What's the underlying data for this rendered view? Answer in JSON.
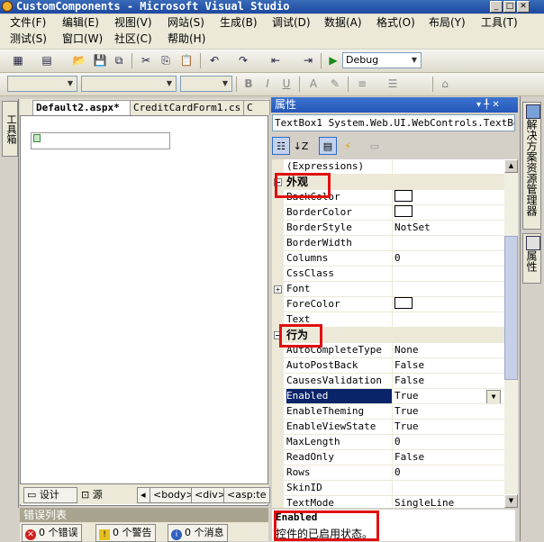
{
  "window": {
    "title": "CustomComponents - Microsoft Visual Studio"
  },
  "menu": {
    "row1": [
      "文件(F)",
      "编辑(E)",
      "视图(V)",
      "网站(S)",
      "生成(B)",
      "调试(D)",
      "数据(A)",
      "格式(O)",
      "布局(Y)",
      "工具(T)"
    ],
    "row2": [
      "测试(S)",
      "窗口(W)",
      "社区(C)",
      "帮助(H)"
    ]
  },
  "toolbar": {
    "config_combo": "Debug"
  },
  "toolbox": {
    "label": "工具箱"
  },
  "document": {
    "tabs": [
      "Default2.aspx*",
      "CreditCardForm1.cs",
      "C"
    ],
    "design_button": "设计",
    "source_button": "源",
    "breadcrumbs": [
      "<body>",
      "<div>",
      "<asp:te"
    ]
  },
  "error_list": {
    "title": "错误列表",
    "errors": "0 个错误",
    "warnings": "0 个警告",
    "messages": "0 个消息"
  },
  "properties": {
    "title": "属性",
    "pin": "▾ ╀ ✕",
    "object": "TextBox1 System.Web.UI.WebControls.TextBox",
    "rows": [
      {
        "name": "(Expressions)",
        "value": ""
      },
      {
        "category": "外观"
      },
      {
        "name": "BackColor",
        "value": "",
        "color": "#ffffff"
      },
      {
        "name": "BorderColor",
        "value": "",
        "color": "#ffffff"
      },
      {
        "name": "BorderStyle",
        "value": "NotSet"
      },
      {
        "name": "BorderWidth",
        "value": ""
      },
      {
        "name": "Columns",
        "value": "0"
      },
      {
        "name": "CssClass",
        "value": ""
      },
      {
        "name": "Font",
        "value": "",
        "expand": "+"
      },
      {
        "name": "ForeColor",
        "value": "",
        "color": "#ffffff"
      },
      {
        "name": "Text",
        "value": ""
      },
      {
        "category": "行为"
      },
      {
        "name": "AutoCompleteType",
        "value": "None"
      },
      {
        "name": "AutoPostBack",
        "value": "False"
      },
      {
        "name": "CausesValidation",
        "value": "False"
      },
      {
        "name": "Enabled",
        "value": "True",
        "selected": true
      },
      {
        "name": "EnableTheming",
        "value": "True"
      },
      {
        "name": "EnableViewState",
        "value": "True"
      },
      {
        "name": "MaxLength",
        "value": "0"
      },
      {
        "name": "ReadOnly",
        "value": "False"
      },
      {
        "name": "Rows",
        "value": "0"
      },
      {
        "name": "SkinID",
        "value": ""
      },
      {
        "name": "TextMode",
        "value": "SingleLine"
      }
    ],
    "description": {
      "name": "Enabled",
      "text": "控件的已启用状态。"
    }
  },
  "right_tabs": [
    "解决方案资源管理器",
    "属性"
  ]
}
